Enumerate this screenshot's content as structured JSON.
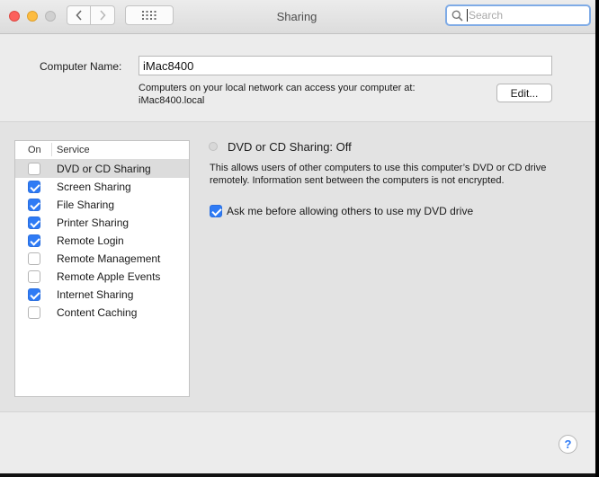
{
  "window": {
    "title": "Sharing"
  },
  "search": {
    "placeholder": "Search"
  },
  "computer_name": {
    "label": "Computer Name:",
    "value": "iMac8400",
    "description_line1": "Computers on your local network can access your computer at:",
    "description_line2": "iMac8400.local",
    "edit_label": "Edit..."
  },
  "services": {
    "header_on": "On",
    "header_service": "Service",
    "items": [
      {
        "name": "DVD or CD Sharing",
        "on": false,
        "selected": true
      },
      {
        "name": "Screen Sharing",
        "on": true,
        "selected": false
      },
      {
        "name": "File Sharing",
        "on": true,
        "selected": false
      },
      {
        "name": "Printer Sharing",
        "on": true,
        "selected": false
      },
      {
        "name": "Remote Login",
        "on": true,
        "selected": false
      },
      {
        "name": "Remote Management",
        "on": false,
        "selected": false
      },
      {
        "name": "Remote Apple Events",
        "on": false,
        "selected": false
      },
      {
        "name": "Internet Sharing",
        "on": true,
        "selected": false
      },
      {
        "name": "Content Caching",
        "on": false,
        "selected": false
      }
    ]
  },
  "detail": {
    "status": "DVD or CD Sharing: Off",
    "description_line1": "This allows users of other computers to use this computer’s DVD or CD drive",
    "description_line2": "remotely. Information sent between the computers is not encrypted.",
    "ask_label": "Ask me before allowing others to use my DVD drive",
    "ask_checked": true
  },
  "help": {
    "label": "?"
  },
  "colors": {
    "accent": "#2f7bf5",
    "search_focus": "#7fabe6"
  }
}
